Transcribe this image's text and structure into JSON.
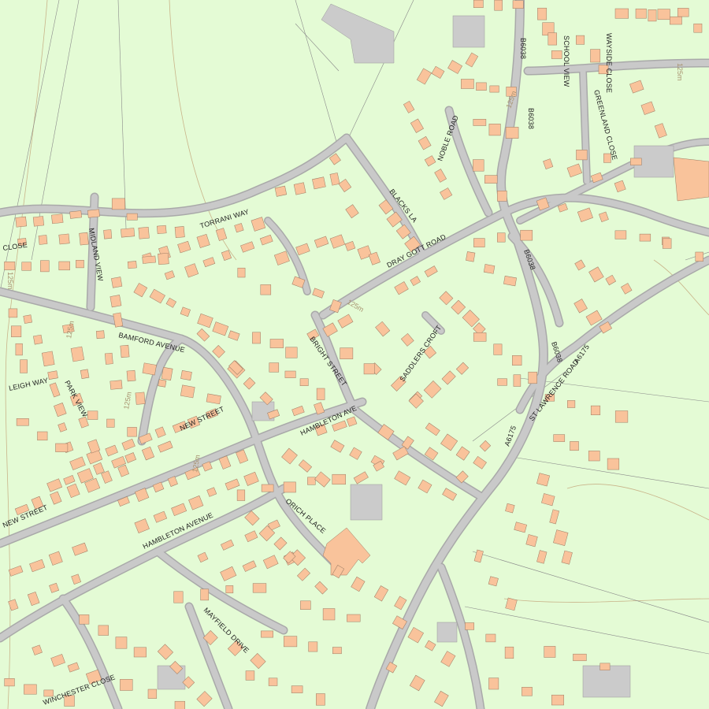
{
  "colors": {
    "land": "#e4fbd5",
    "road": "#c9c9c9",
    "building": "#f9c39b",
    "large_building": "#cbcbcb",
    "plot_line": "#8a8a8a",
    "contour": "#c9b48a"
  },
  "labels": {
    "torrani_way": "TORRANI WAY",
    "blacks_la": "BLACKS LA",
    "dray_gott_road": "DRAY GOTT ROAD",
    "noble_road": "NOBLE ROAD",
    "b6038_north": "B6038",
    "b6038_a": "B6038",
    "b6038_b": "B6038",
    "b6038_c": "B6038",
    "school_view": "SCHOOL VIEW",
    "wayside_close": "WAYSIDE CLOSE",
    "greenland_close": "GREENLAND CLOSE",
    "close_w": "CLOSE",
    "midland_view": "MIDLAND VIEW",
    "bamford_avenue": "BAMFORD AVENUE",
    "leigh_way": "LEIGH WAY",
    "park_view": "PARK VIEW",
    "bright_street": "BRIGHT STREET",
    "saddlers_croft": "SADDLERS CROFT",
    "hambleton_ave": "HAMBLETON AVE",
    "new_street_mid": "NEW STREET",
    "new_street_w": "NEW STREET",
    "hambleton_avenue": "HAMBLETON AVENUE",
    "orich_place": "ORICH PLACE",
    "mayfield_drive": "MAYFIELD DRIVE",
    "winchester_close": "WINCHESTER CLOSE",
    "st_lawrence_road": "ST LAWRENCE ROAD",
    "a6175_a": "A6175",
    "a6175_b": "A6175"
  },
  "heights": {
    "h125_ne": "125m",
    "h125_w": "125m",
    "h125_n": "125m",
    "h125_c": "125m",
    "h125_s": "125m",
    "h125_x": "125m",
    "h125_mid": "125m"
  }
}
